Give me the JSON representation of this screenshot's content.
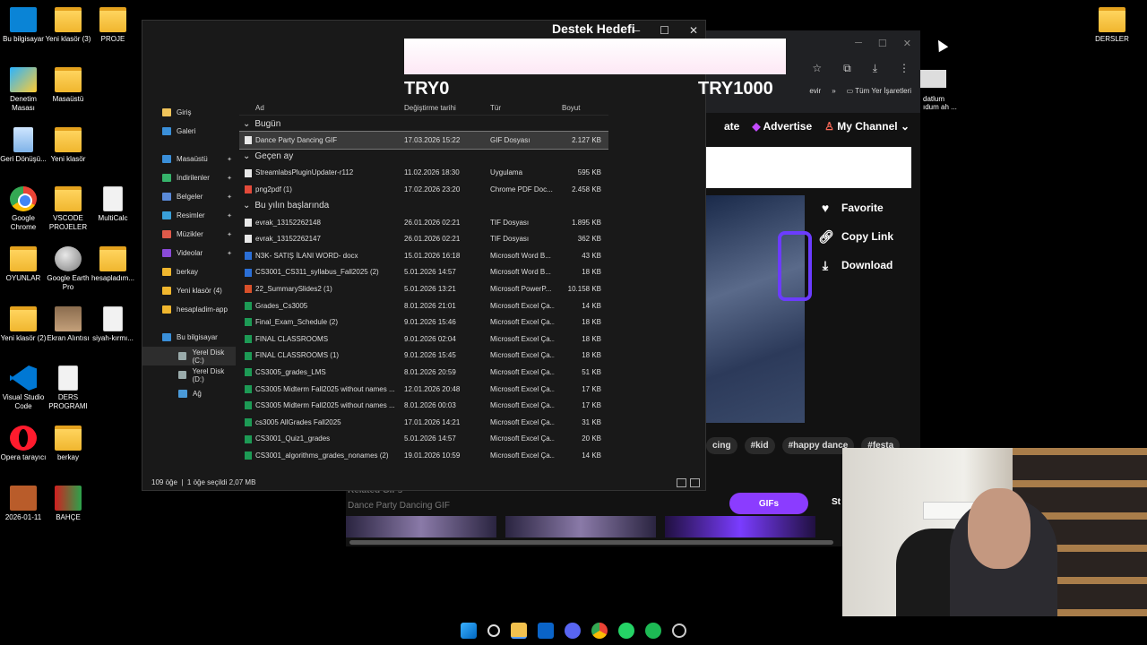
{
  "desktop_left": [
    {
      "label": "Bu bilgisayar",
      "icon": "monitor-icon"
    },
    {
      "label": "Yeni klasör (3)",
      "icon": "folder-icon"
    },
    {
      "label": "PROJE",
      "icon": "folder-icon"
    },
    {
      "label": "Denetim Masası",
      "icon": "control-panel-icon"
    },
    {
      "label": "Masaüstü",
      "icon": "folder-icon"
    },
    {
      "label": "Geri Dönüşü...",
      "icon": "recycle-bin-icon"
    },
    {
      "label": "Yeni klasör",
      "icon": "folder-icon"
    },
    {
      "label": "Google Chrome",
      "icon": "chrome-icon"
    },
    {
      "label": "VSCODE PROJELER",
      "icon": "folder-icon"
    },
    {
      "label": "MultiCalc",
      "icon": "document-icon"
    },
    {
      "label": "OYUNLAR",
      "icon": "folder-icon"
    },
    {
      "label": "Google Earth Pro",
      "icon": "google-earth-icon"
    },
    {
      "label": "hesapladım...",
      "icon": "folder-icon"
    },
    {
      "label": "Yeni klasör (2)",
      "icon": "folder-icon"
    },
    {
      "label": "Ekran Alıntısı",
      "icon": "photo-icon"
    },
    {
      "label": "siyah-kırmı...",
      "icon": "document-icon"
    },
    {
      "label": "Visual Studio Code",
      "icon": "vscode-icon"
    },
    {
      "label": "DERS PROGRAMI",
      "icon": "document-icon"
    },
    {
      "label": "Opera tarayıcı",
      "icon": "opera-icon"
    },
    {
      "label": "berkay",
      "icon": "folder-icon"
    },
    {
      "label": "2026-01-11",
      "icon": "calendar-image-icon"
    },
    {
      "label": "BAHÇE",
      "icon": "image-icon"
    }
  ],
  "desktop_right": {
    "label": "DERSLER",
    "icon": "folder-icon"
  },
  "stream": {
    "goal_title": "Destek Hedefi",
    "goal_start": "TRY0",
    "goal_end": "TRY1000"
  },
  "explorer": {
    "sidebar": [
      {
        "label": "Giriş",
        "icon": "home-icon"
      },
      {
        "label": "Galeri",
        "icon": "gallery-icon"
      },
      {
        "label": "Masaüstü",
        "icon": "desktop-icon",
        "pinned": true
      },
      {
        "label": "İndirilenler",
        "icon": "download-icon",
        "pinned": true
      },
      {
        "label": "Belgeler",
        "icon": "documents-icon",
        "pinned": true
      },
      {
        "label": "Resimler",
        "icon": "pictures-icon",
        "pinned": true
      },
      {
        "label": "Müzikler",
        "icon": "music-icon",
        "pinned": true
      },
      {
        "label": "Videolar",
        "icon": "videos-icon",
        "pinned": true
      },
      {
        "label": "berkay",
        "icon": "folder-icon"
      },
      {
        "label": "Yeni klasör (4)",
        "icon": "folder-icon"
      },
      {
        "label": "hesapladim-app",
        "icon": "folder-icon"
      },
      {
        "label": "Bu bilgisayar",
        "icon": "monitor-icon"
      },
      {
        "label": "Yerel Disk (C:)",
        "icon": "drive-icon"
      },
      {
        "label": "Yerel Disk (D:)",
        "icon": "drive-icon"
      },
      {
        "label": "Ağ",
        "icon": "network-icon"
      }
    ],
    "columns": {
      "name": "Ad",
      "modified": "Değiştirme tarihi",
      "type": "Tür",
      "size": "Boyut"
    },
    "groups": [
      {
        "title": "Bugün",
        "files": [
          {
            "name": "Dance Party Dancing GIF",
            "modified": "17.03.2026 15:22",
            "type": "GIF Dosyası",
            "size": "2.127 KB",
            "selected": true
          }
        ]
      },
      {
        "title": "Geçen ay",
        "files": [
          {
            "name": "StreamlabsPluginUpdater-r112",
            "modified": "11.02.2026 18:30",
            "type": "Uygulama",
            "size": "595 KB"
          },
          {
            "name": "png2pdf (1)",
            "modified": "17.02.2026 23:20",
            "type": "Chrome PDF Doc...",
            "size": "2.458 KB"
          }
        ]
      },
      {
        "title": "Bu yılın başlarında",
        "files": [
          {
            "name": "evrak_13152262148",
            "modified": "26.01.2026 02:21",
            "type": "TIF Dosyası",
            "size": "1.895 KB"
          },
          {
            "name": "evrak_13152262147",
            "modified": "26.01.2026 02:21",
            "type": "TIF Dosyası",
            "size": "362 KB"
          },
          {
            "name": "N3K- SATIŞ İLANI  WORD- docx",
            "modified": "15.01.2026 16:18",
            "type": "Microsoft Word B...",
            "size": "43 KB"
          },
          {
            "name": "CS3001_CS311_syllabus_Fall2025 (2)",
            "modified": "5.01.2026 14:57",
            "type": "Microsoft Word B...",
            "size": "18 KB"
          },
          {
            "name": "22_SummarySlides2 (1)",
            "modified": "5.01.2026 13:21",
            "type": "Microsoft PowerP...",
            "size": "10.158 KB"
          },
          {
            "name": "Grades_Cs3005",
            "modified": "8.01.2026 21:01",
            "type": "Microsoft Excel Ça...",
            "size": "14 KB"
          },
          {
            "name": "Final_Exam_Schedule (2)",
            "modified": "9.01.2026 15:46",
            "type": "Microsoft Excel Ça...",
            "size": "18 KB"
          },
          {
            "name": "FINAL CLASSROOMS",
            "modified": "9.01.2026 02:04",
            "type": "Microsoft Excel Ça...",
            "size": "18 KB"
          },
          {
            "name": "FINAL CLASSROOMS (1)",
            "modified": "9.01.2026 15:45",
            "type": "Microsoft Excel Ça...",
            "size": "18 KB"
          },
          {
            "name": "CS3005_grades_LMS",
            "modified": "8.01.2026 20:59",
            "type": "Microsoft Excel Ça...",
            "size": "51 KB"
          },
          {
            "name": "CS3005 Midterm Fall2025 without names ...",
            "modified": "12.01.2026 20:48",
            "type": "Microsoft Excel Ça...",
            "size": "17 KB"
          },
          {
            "name": "CS3005 Midterm Fall2025 without names ...",
            "modified": "8.01.2026 00:03",
            "type": "Microsoft Excel Ça...",
            "size": "17 KB"
          },
          {
            "name": "cs3005 AllGrades Fall2025",
            "modified": "17.01.2026 14:21",
            "type": "Microsoft Excel Ça...",
            "size": "31 KB"
          },
          {
            "name": "CS3001_Quiz1_grades",
            "modified": "5.01.2026 14:57",
            "type": "Microsoft Excel Ça...",
            "size": "20 KB"
          },
          {
            "name": "CS3001_algorithms_grades_nonames (2)",
            "modified": "19.01.2026 10:59",
            "type": "Microsoft Excel Ça...",
            "size": "14 KB"
          }
        ]
      }
    ],
    "status": {
      "count": "109 öğe",
      "selected": "1 öğe seçildi",
      "size": "2,07 MB"
    }
  },
  "browser": {
    "bookmarks_folder": "Tüm Yer İşaretleri",
    "bookmark_partial": "evir",
    "nav": {
      "left_partial": "ate",
      "advertise": "Advertise",
      "channel": "My Channel"
    },
    "actions": [
      {
        "label": "Favorite",
        "icon": "heart-icon"
      },
      {
        "label": "Copy Link",
        "icon": "link-icon"
      },
      {
        "label": "Download",
        "icon": "download-icon"
      }
    ],
    "tags": [
      "cing",
      "#kid",
      "#happy dance",
      "#festa"
    ],
    "related_title": "Related GIFs",
    "related_sub": "Dance Party Dancing GIF",
    "gifs_button": "GIFs",
    "st_partial": "St"
  },
  "desktop_partial_label": "datlum\nıdum ah ..."
}
